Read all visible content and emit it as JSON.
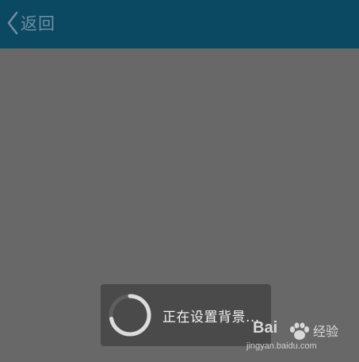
{
  "header": {
    "back_label": "返回",
    "background_color": "#0b4862",
    "back_icon": "chevron-left-icon"
  },
  "content": {
    "background_color": "#686868"
  },
  "toast": {
    "message": "正在设置背景...",
    "icon": "loading-spinner-icon"
  },
  "watermark": {
    "brand": "Bai",
    "paw_icon": "baidu-paw-icon",
    "suffix": "经验",
    "url": "jingyan.baidu.com"
  }
}
